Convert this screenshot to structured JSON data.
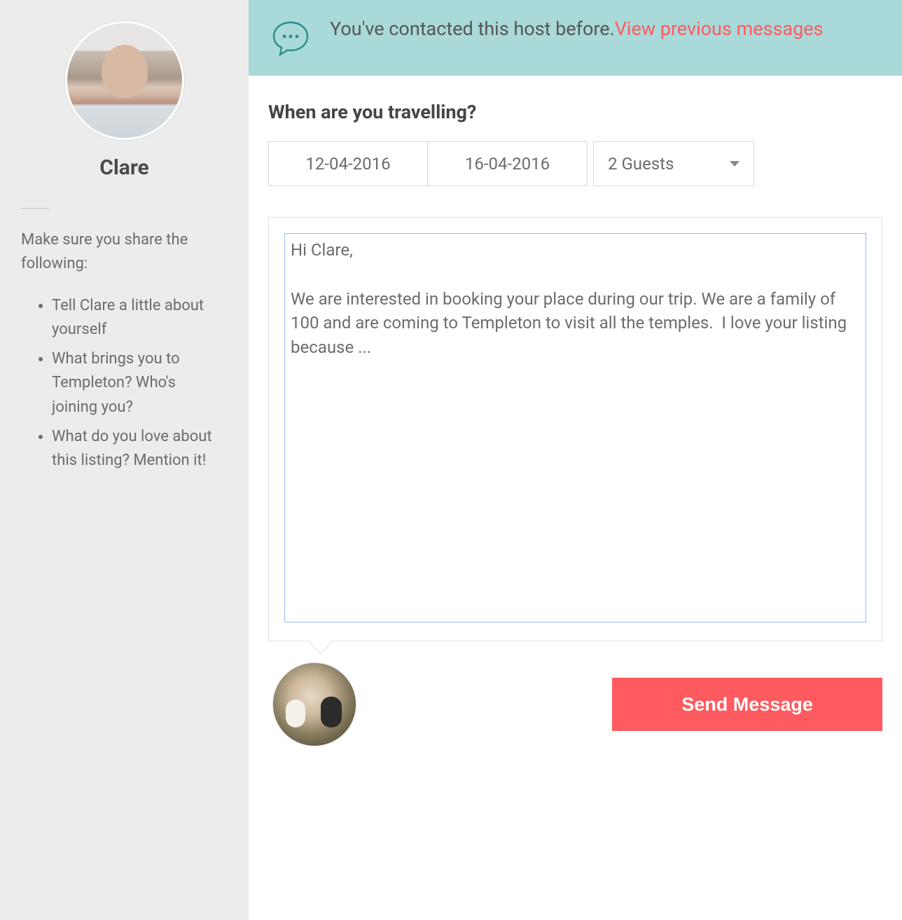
{
  "sidebar": {
    "host_name": "Clare",
    "prompt_text": "Make sure you share the following:",
    "tips": [
      "Tell Clare a little about yourself",
      "What brings you to Templeton? Who's joining you?",
      "What do you love about this listing? Mention it!"
    ]
  },
  "banner": {
    "text": "You've contacted this host before.",
    "link_text": "View previous messages"
  },
  "form": {
    "question": "When are you travelling?",
    "checkin": "12-04-2016",
    "checkout": "16-04-2016",
    "guests_label": "2 Guests"
  },
  "message": {
    "value": "Hi Clare,\n\nWe are interested in booking your place during our trip. We are a family of 100 and are coming to Templeton to visit all the temples.  I love your listing because ..."
  },
  "actions": {
    "send_label": "Send Message"
  },
  "colors": {
    "banner_bg": "#a9d9d9",
    "accent": "#ff5a5f",
    "sidebar_bg": "#ececec"
  }
}
